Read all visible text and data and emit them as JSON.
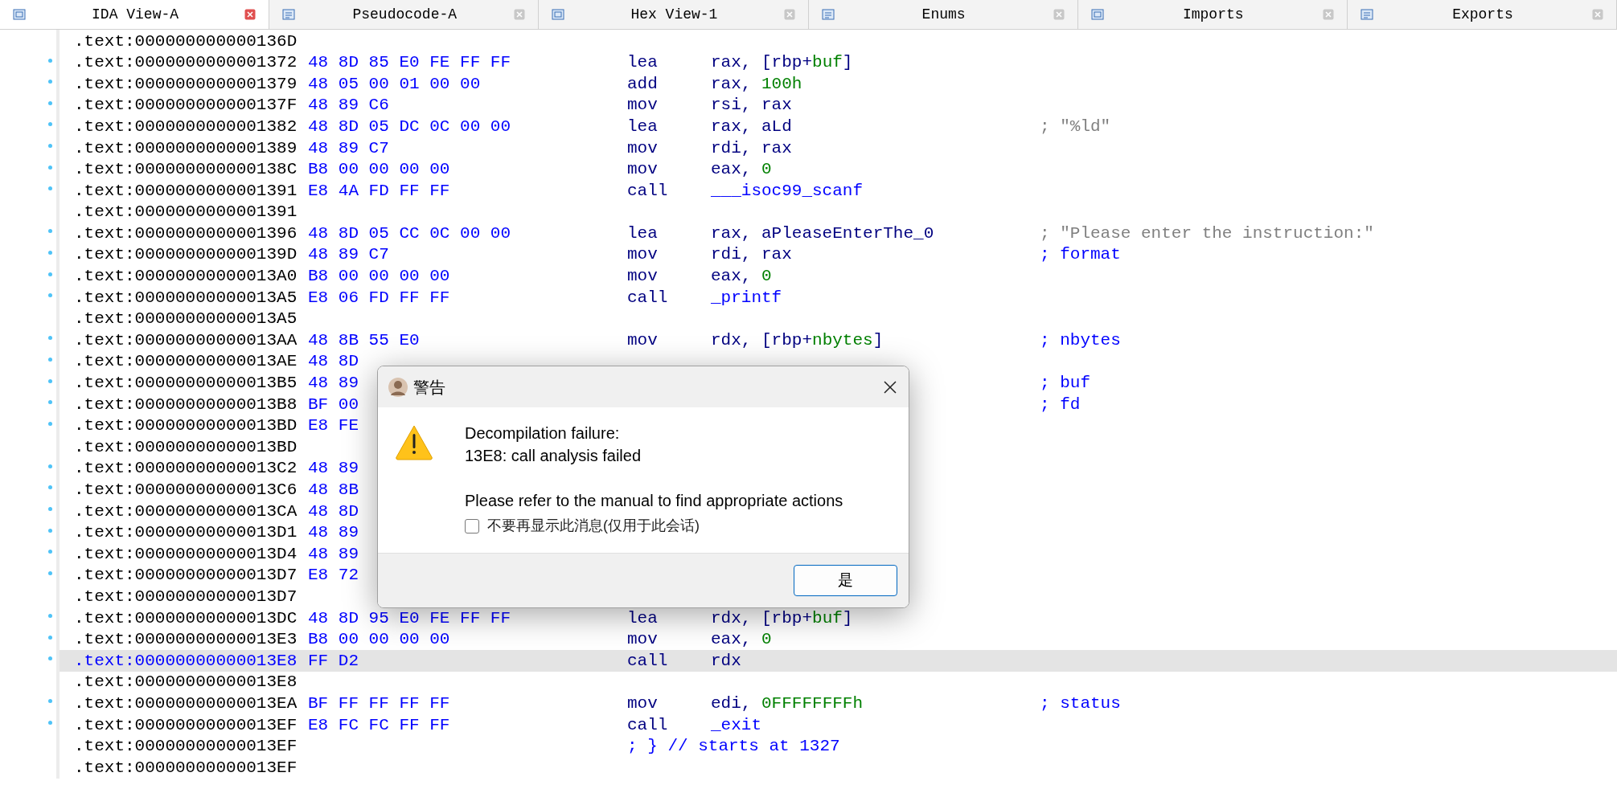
{
  "tabs": [
    {
      "label": "IDA View-A",
      "selected": true
    },
    {
      "label": "Pseudocode-A",
      "selected": false
    },
    {
      "label": "Hex View-1",
      "selected": false
    },
    {
      "label": "Enums",
      "selected": false
    },
    {
      "label": "Imports",
      "selected": false
    },
    {
      "label": "Exports",
      "selected": false
    }
  ],
  "listing": [
    {
      "address": ".text:000000000000136D",
      "dot": false,
      "selected": false
    },
    {
      "address": ".text:0000000000001372",
      "dot": true,
      "selected": false,
      "bytes": "48 8D 85 E0 FE FF FF",
      "mnemonic": "lea",
      "operands": [
        {
          "text": "rax, [rbp+",
          "kind": "reg"
        },
        {
          "text": "buf",
          "kind": "var"
        },
        {
          "text": "]",
          "kind": "reg"
        }
      ]
    },
    {
      "address": ".text:0000000000001379",
      "dot": true,
      "selected": false,
      "bytes": "48 05 00 01 00 00",
      "mnemonic": "add",
      "operands": [
        {
          "text": "rax, ",
          "kind": "reg"
        },
        {
          "text": "100h",
          "kind": "num"
        }
      ]
    },
    {
      "address": ".text:000000000000137F",
      "dot": true,
      "selected": false,
      "bytes": "48 89 C6",
      "mnemonic": "mov",
      "operands": [
        {
          "text": "rsi, rax",
          "kind": "reg"
        }
      ]
    },
    {
      "address": ".text:0000000000001382",
      "dot": true,
      "selected": false,
      "bytes": "48 8D 05 DC 0C 00 00",
      "mnemonic": "lea",
      "operands": [
        {
          "text": "rax, aLd",
          "kind": "reg"
        }
      ],
      "comment": {
        "text": "; \"%ld\"",
        "kind": "string"
      }
    },
    {
      "address": ".text:0000000000001389",
      "dot": true,
      "selected": false,
      "bytes": "48 89 C7",
      "mnemonic": "mov",
      "operands": [
        {
          "text": "rdi, rax",
          "kind": "reg"
        }
      ]
    },
    {
      "address": ".text:000000000000138C",
      "dot": true,
      "selected": false,
      "bytes": "B8 00 00 00 00",
      "mnemonic": "mov",
      "operands": [
        {
          "text": "eax, ",
          "kind": "reg"
        },
        {
          "text": "0",
          "kind": "num"
        }
      ]
    },
    {
      "address": ".text:0000000000001391",
      "dot": true,
      "selected": false,
      "bytes": "E8 4A FD FF FF",
      "mnemonic": "call",
      "operands": [
        {
          "text": "___isoc99_scanf",
          "kind": "name"
        }
      ]
    },
    {
      "address": ".text:0000000000001391",
      "dot": false,
      "selected": false
    },
    {
      "address": ".text:0000000000001396",
      "dot": true,
      "selected": false,
      "bytes": "48 8D 05 CC 0C 00 00",
      "mnemonic": "lea",
      "operands": [
        {
          "text": "rax, aPleaseEnterThe_0",
          "kind": "reg"
        }
      ],
      "comment": {
        "text": "; \"Please enter the instruction:\"",
        "kind": "string"
      }
    },
    {
      "address": ".text:000000000000139D",
      "dot": true,
      "selected": false,
      "bytes": "48 89 C7",
      "mnemonic": "mov",
      "operands": [
        {
          "text": "rdi, rax",
          "kind": "reg"
        }
      ],
      "comment": {
        "text": "; format",
        "kind": "ref"
      }
    },
    {
      "address": ".text:00000000000013A0",
      "dot": true,
      "selected": false,
      "bytes": "B8 00 00 00 00",
      "mnemonic": "mov",
      "operands": [
        {
          "text": "eax, ",
          "kind": "reg"
        },
        {
          "text": "0",
          "kind": "num"
        }
      ]
    },
    {
      "address": ".text:00000000000013A5",
      "dot": true,
      "selected": false,
      "bytes": "E8 06 FD FF FF",
      "mnemonic": "call",
      "operands": [
        {
          "text": "_printf",
          "kind": "name"
        }
      ]
    },
    {
      "address": ".text:00000000000013A5",
      "dot": false,
      "selected": false
    },
    {
      "address": ".text:00000000000013AA",
      "dot": true,
      "selected": false,
      "bytes": "48 8B 55 E0",
      "mnemonic": "mov",
      "operands": [
        {
          "text": "rdx, [rbp+",
          "kind": "reg"
        },
        {
          "text": "nbytes",
          "kind": "var"
        },
        {
          "text": "]",
          "kind": "reg"
        }
      ],
      "comment": {
        "text": "; nbytes",
        "kind": "ref"
      }
    },
    {
      "address": ".text:00000000000013AE",
      "dot": true,
      "selected": false,
      "bytes": "48 8D"
    },
    {
      "address": ".text:00000000000013B5",
      "dot": true,
      "selected": false,
      "bytes": "48 89",
      "comment": {
        "text": "; buf",
        "kind": "ref"
      }
    },
    {
      "address": ".text:00000000000013B8",
      "dot": true,
      "selected": false,
      "bytes": "BF 00",
      "comment": {
        "text": "; fd",
        "kind": "ref"
      }
    },
    {
      "address": ".text:00000000000013BD",
      "dot": true,
      "selected": false,
      "bytes": "E8 FE"
    },
    {
      "address": ".text:00000000000013BD",
      "dot": false,
      "selected": false
    },
    {
      "address": ".text:00000000000013C2",
      "dot": true,
      "selected": false,
      "bytes": "48 89"
    },
    {
      "address": ".text:00000000000013C6",
      "dot": true,
      "selected": false,
      "bytes": "48 8B"
    },
    {
      "address": ".text:00000000000013CA",
      "dot": true,
      "selected": false,
      "bytes": "48 8D"
    },
    {
      "address": ".text:00000000000013D1",
      "dot": true,
      "selected": false,
      "bytes": "48 89"
    },
    {
      "address": ".text:00000000000013D4",
      "dot": true,
      "selected": false,
      "bytes": "48 89"
    },
    {
      "address": ".text:00000000000013D7",
      "dot": true,
      "selected": false,
      "bytes": "E8 72"
    },
    {
      "address": ".text:00000000000013D7",
      "dot": false,
      "selected": false
    },
    {
      "address": ".text:00000000000013DC",
      "dot": true,
      "selected": false,
      "bytes": "48 8D 95 E0 FE FF FF",
      "mnemonic": "lea",
      "operands": [
        {
          "text": "rdx, [rbp+",
          "kind": "reg"
        },
        {
          "text": "buf",
          "kind": "var"
        },
        {
          "text": "]",
          "kind": "reg"
        }
      ]
    },
    {
      "address": ".text:00000000000013E3",
      "dot": true,
      "selected": false,
      "bytes": "B8 00 00 00 00",
      "mnemonic": "mov",
      "operands": [
        {
          "text": "eax, ",
          "kind": "reg"
        },
        {
          "text": "0",
          "kind": "num"
        }
      ]
    },
    {
      "address": ".text:00000000000013E8",
      "dot": true,
      "selected": true,
      "bytes": "FF D2",
      "mnemonic": "call",
      "operands": [
        {
          "text": "rdx",
          "kind": "reg"
        }
      ]
    },
    {
      "address": ".text:00000000000013E8",
      "dot": false,
      "selected": false
    },
    {
      "address": ".text:00000000000013EA",
      "dot": true,
      "selected": false,
      "bytes": "BF FF FF FF FF",
      "mnemonic": "mov",
      "operands": [
        {
          "text": "edi, ",
          "kind": "reg"
        },
        {
          "text": "0FFFFFFFFh",
          "kind": "num"
        }
      ],
      "comment": {
        "text": "; status",
        "kind": "ref"
      }
    },
    {
      "address": ".text:00000000000013EF",
      "dot": true,
      "selected": false,
      "bytes": "E8 FC FC FF FF",
      "mnemonic": "call",
      "operands": [
        {
          "text": "_exit",
          "kind": "name"
        }
      ]
    },
    {
      "address": ".text:00000000000013EF",
      "dot": false,
      "selected": false,
      "note": "; } // starts at 1327"
    },
    {
      "address": ".text:00000000000013EF",
      "dot": false,
      "selected": false
    }
  ],
  "dialog": {
    "title": "警告",
    "message_lines": [
      "Decompilation failure:",
      "13E8: call analysis failed"
    ],
    "hint": "Please refer to the manual to find appropriate actions",
    "checkbox": {
      "label": "不要再显示此消息(仅用于此会话)",
      "checked": false
    },
    "button": "是"
  }
}
